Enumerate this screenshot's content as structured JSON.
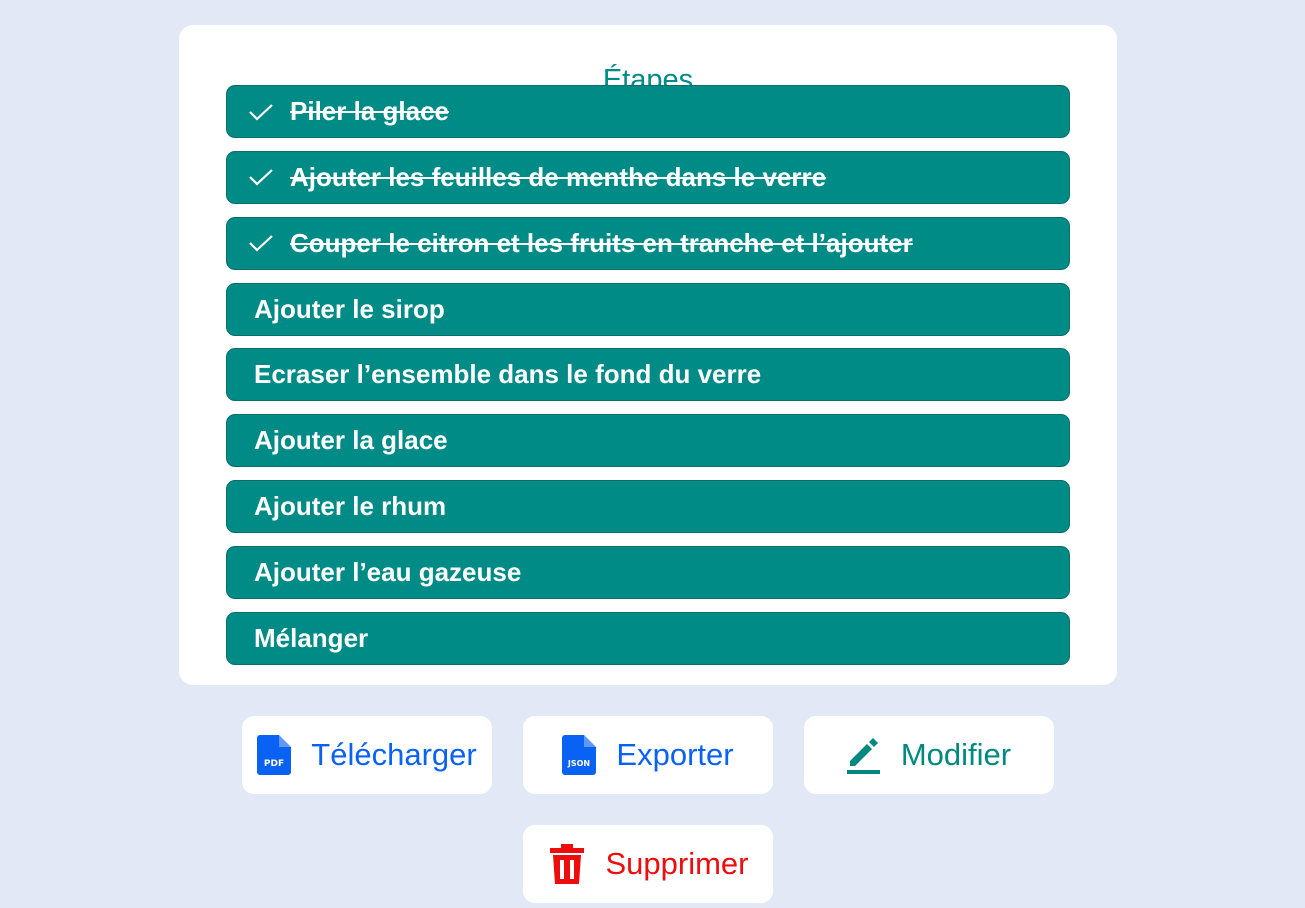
{
  "steps_card": {
    "title": "Étapes",
    "items": [
      {
        "label": "Piler la glace",
        "done": true
      },
      {
        "label": "Ajouter les feuilles de menthe dans le verre",
        "done": true
      },
      {
        "label": "Couper le citron et les fruits en tranche et l’ajouter",
        "done": true
      },
      {
        "label": "Ajouter le sirop",
        "done": false
      },
      {
        "label": "Ecraser l’ensemble dans le fond du verre",
        "done": false
      },
      {
        "label": "Ajouter la glace",
        "done": false
      },
      {
        "label": "Ajouter le rhum",
        "done": false
      },
      {
        "label": "Ajouter l’eau gazeuse",
        "done": false
      },
      {
        "label": "Mélanger",
        "done": false
      }
    ]
  },
  "actions": {
    "download_label": "Télécharger",
    "download_icon": "pdf-file-icon",
    "export_label": "Exporter",
    "export_icon": "json-file-icon",
    "edit_label": "Modifier",
    "edit_icon": "pencil-icon",
    "delete_label": "Supprimer",
    "delete_icon": "trash-icon",
    "pdf_icon_text": "PDF",
    "json_icon_text": "JSON"
  },
  "colors": {
    "background": "#e2e8f6",
    "teal": "#008b87",
    "blue": "#0a62f5",
    "red": "#ee0d0d",
    "card": "#ffffff"
  }
}
